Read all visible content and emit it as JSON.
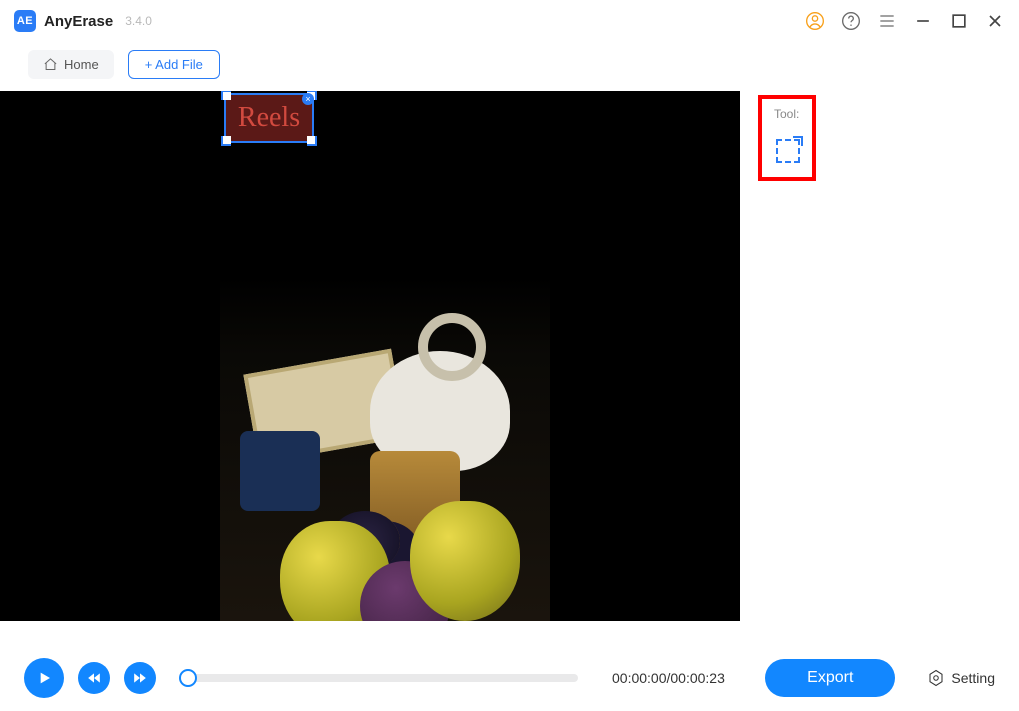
{
  "app": {
    "name": "AnyErase",
    "version": "3.4.0"
  },
  "toolbar": {
    "home_label": "Home",
    "add_file_label": "+ Add File"
  },
  "canvas": {
    "watermark_text": "Reels"
  },
  "side": {
    "tool_label": "Tool:"
  },
  "player": {
    "timecode": "00:00:00/00:00:23"
  },
  "actions": {
    "export_label": "Export",
    "setting_label": "Setting"
  }
}
